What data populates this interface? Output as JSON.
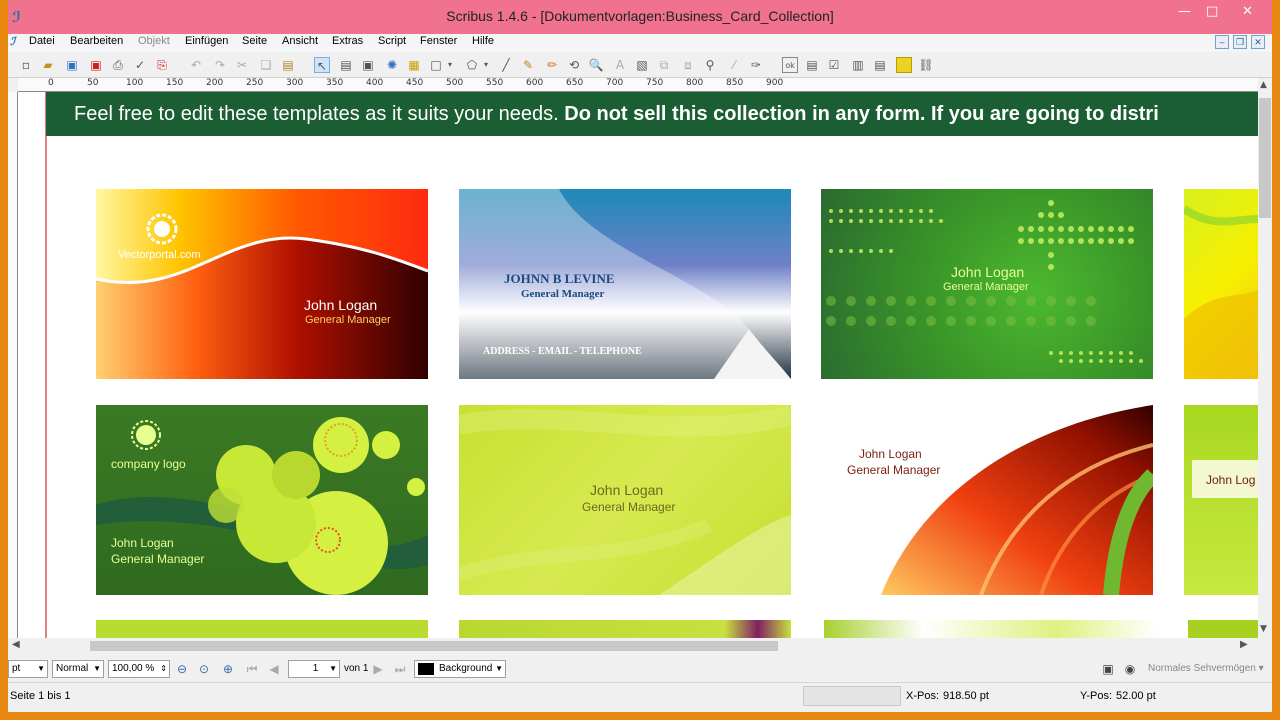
{
  "window": {
    "title": "Scribus 1.4.6 - [Dokumentvorlagen:Business_Card_Collection]",
    "minimize": "—",
    "maximize": "□",
    "close": "✕"
  },
  "menu": [
    "Datei",
    "Bearbeiten",
    "Objekt",
    "Einfügen",
    "Seite",
    "Ansicht",
    "Extras",
    "Script",
    "Fenster",
    "Hilfe"
  ],
  "ruler_labels": [
    "0",
    "50",
    "100",
    "150",
    "200",
    "250",
    "300",
    "350",
    "400",
    "450",
    "500",
    "550",
    "600",
    "650",
    "700",
    "750",
    "800",
    "850",
    "900"
  ],
  "banner": {
    "normal": "Feel free to edit these templates as it suits your needs.",
    "bold": "Do not sell this collection in any form. If you are going to distri"
  },
  "cards": {
    "c1": {
      "logo": "Vectorportal.com",
      "name": "John Logan",
      "role": "General Manager"
    },
    "c2": {
      "name": "JOHNN B LEVINE",
      "role": "General Manager",
      "contact": "ADDRESS - EMAIL - TELEPHONE"
    },
    "c3": {
      "name": "John Logan",
      "role": "General Manager"
    },
    "c5": {
      "logo": "company logo",
      "name": "John Logan",
      "role": "General Manager"
    },
    "c6": {
      "name": "John Logan",
      "role": "General Manager"
    },
    "c7": {
      "name": "John Logan",
      "role": "General Manager"
    },
    "c8": {
      "name": "John Log"
    }
  },
  "bottombar": {
    "unit": "pt",
    "mode": "Normal",
    "zoom": "100,00 %",
    "page": "1",
    "of_pages": "von 1",
    "layer": "Background",
    "view_mode": "Normales Sehvermögen"
  },
  "status": {
    "page": "Seite 1 bis 1",
    "x_label": "X-Pos:",
    "x_value": "918.50 pt",
    "y_label": "Y-Pos:",
    "y_value": "52.00 pt"
  },
  "colors": {
    "titlebar": "#f0728e",
    "banner": "#1b5e33",
    "border": "#e8870f"
  }
}
